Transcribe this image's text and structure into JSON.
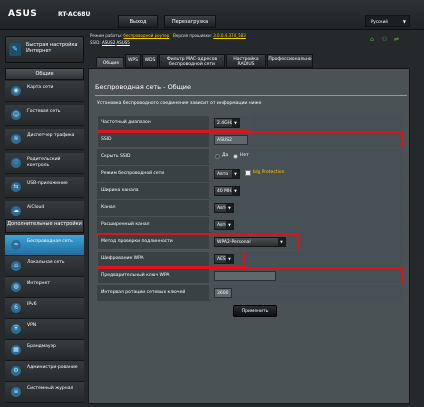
{
  "header": {
    "logo": "ASUS",
    "model": "RT-AC68U",
    "logout_label": "Выход",
    "reboot_label": "Перезагрузка",
    "language": "Русский"
  },
  "info": {
    "mode_label": "Режим работы:",
    "mode_value": "беспроводной роутер",
    "fw_label": "Версия прошивки:",
    "fw_value": "3.0.0.4.374_583",
    "ssid_label": "SSID:",
    "ssid_1": "ASUS2",
    "ssid_2": "ASUS5"
  },
  "sidebar": {
    "quick_setup": "Быстрая настройка Интернет",
    "general_header": "Общие",
    "general_items": [
      {
        "label": "Карта сети",
        "icon": "network-map-icon"
      },
      {
        "label": "Гостевая сеть",
        "icon": "guest-network-icon"
      },
      {
        "label": "Диспетчер трафика",
        "icon": "traffic-manager-icon"
      },
      {
        "label": "Родительский контроль",
        "icon": "parental-control-icon"
      },
      {
        "label": "USB-приложение",
        "icon": "usb-icon"
      },
      {
        "label": "AiCloud",
        "icon": "cloud-icon"
      }
    ],
    "advanced_header": "Дополнительные настройки",
    "advanced_items": [
      {
        "label": "Беспроводная сеть",
        "icon": "wireless-icon"
      },
      {
        "label": "Локальная сеть",
        "icon": "lan-icon"
      },
      {
        "label": "Интернет",
        "icon": "globe-icon"
      },
      {
        "label": "IPv6",
        "icon": "ipv6-icon"
      },
      {
        "label": "VPN",
        "icon": "vpn-icon"
      },
      {
        "label": "Брандмауэр",
        "icon": "firewall-icon"
      },
      {
        "label": "Администри-рование",
        "icon": "admin-icon"
      },
      {
        "label": "Системный журнал",
        "icon": "log-icon"
      }
    ]
  },
  "tabs": [
    "Общие",
    "WPS",
    "WDS",
    "Фильтр MAC-адресов беспроводной сети",
    "Настройка RADIUS",
    "Профессионально"
  ],
  "panel": {
    "title": "Беспроводная сеть - Общие",
    "description": "Установка беспроводного соединения зависит от информации ниже",
    "rows": [
      {
        "label": "Частотный диапазон",
        "value": "2.4GHz"
      },
      {
        "label": "SSID",
        "value": "ASUS2"
      },
      {
        "label": "Скрыть SSID",
        "yes": "Да",
        "no": "Нет"
      },
      {
        "label": "Режим беспроводной сети",
        "value": "Авто",
        "extra": "b/g Protection"
      },
      {
        "label": "Ширина канала",
        "value": "40 MHz"
      },
      {
        "label": "Канал",
        "value": "Авто"
      },
      {
        "label": "Расширенный канал",
        "value": "Авто"
      },
      {
        "label": "Метод проверки подлинности",
        "value": "WPA2-Personal"
      },
      {
        "label": "Шифрование WPA",
        "value": "AES"
      },
      {
        "label": "Предварительный ключ WPA",
        "value": ""
      },
      {
        "label": "Интервал ротации сетевых ключей",
        "value": "3600"
      }
    ],
    "apply_label": "Применить"
  }
}
